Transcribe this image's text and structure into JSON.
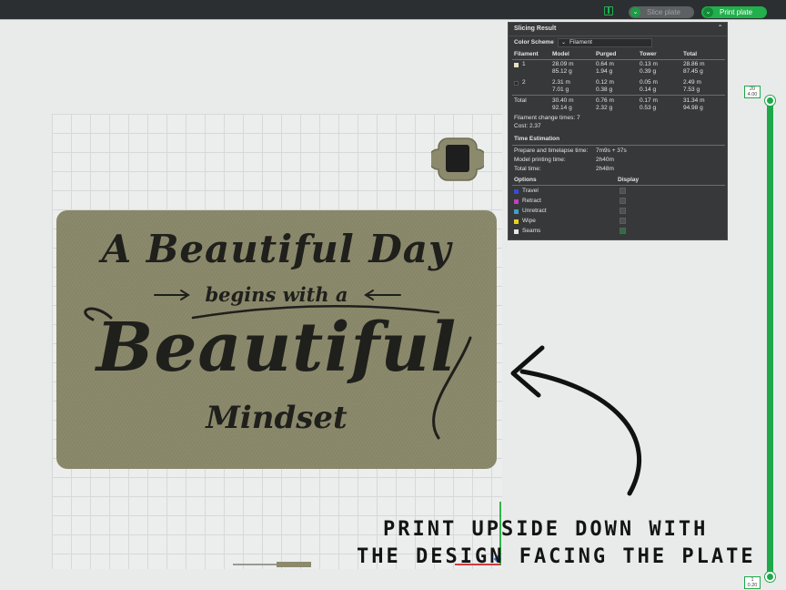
{
  "toolbar": {
    "slice_label": "Slice plate",
    "print_label": "Print plate",
    "layout_icon": "layout-icon",
    "dropdown_icon": "chevron-down-icon",
    "colors": {
      "accent": "#21b04b",
      "bar": "#2c2f31"
    }
  },
  "model": {
    "line1": "A Beautiful Day",
    "line2": "begins with a",
    "line3": "Beautiful",
    "line4": "Mindset",
    "color": "#8c8a6c"
  },
  "slicing_result": {
    "title": "Slicing Result",
    "color_scheme_label": "Color Scheme",
    "color_scheme_value": "Filament",
    "headers": [
      "Filament",
      "Model",
      "Purged",
      "Tower",
      "Total"
    ],
    "rows": [
      {
        "id": "1",
        "color": "#e6e1c4",
        "model": [
          "28.09 m",
          "85.12 g"
        ],
        "purged": [
          "0.64 m",
          "1.94 g"
        ],
        "tower": [
          "0.13 m",
          "0.39 g"
        ],
        "total": [
          "28.86 m",
          "87.45 g"
        ]
      },
      {
        "id": "2",
        "color": "#2a2a2a",
        "model": [
          "2.31 m",
          "7.01 g"
        ],
        "purged": [
          "0.12 m",
          "0.38 g"
        ],
        "tower": [
          "0.05 m",
          "0.14 g"
        ],
        "total": [
          "2.49 m",
          "7.53 g"
        ]
      }
    ],
    "total_row": {
      "label": "Total",
      "model": [
        "30.40 m",
        "92.14 g"
      ],
      "purged": [
        "0.76 m",
        "2.32 g"
      ],
      "tower": [
        "0.17 m",
        "0.53 g"
      ],
      "total": [
        "31.34 m",
        "94.98 g"
      ]
    },
    "filament_changes": "Filament change times:  7",
    "cost": "Cost:  2.37",
    "time_title": "Time Estimation",
    "time_rows": [
      {
        "label": "Prepare and timelapse time:",
        "value": "7m9s + 37s"
      },
      {
        "label": "Model printing time:",
        "value": "2h40m"
      },
      {
        "label": "Total time:",
        "value": "2h48m"
      }
    ],
    "options_header": "Options",
    "display_header": "Display",
    "options": [
      {
        "label": "Travel",
        "color": "#3b4bd8",
        "checked": false
      },
      {
        "label": "Retract",
        "color": "#c040c0",
        "checked": false
      },
      {
        "label": "Unretract",
        "color": "#3fa0c8",
        "checked": false
      },
      {
        "label": "Wipe",
        "color": "#e8d020",
        "checked": false
      },
      {
        "label": "Seams",
        "color": "#e6e6e6",
        "checked": true
      }
    ]
  },
  "layer_slider": {
    "top_layer": "20",
    "top_height": "4.00",
    "bottom_layer": "1",
    "bottom_height": "0.20"
  },
  "annotation": {
    "line1": "PRINT UPSIDE DOWN WITH",
    "line2": "THE DESIGN FACING THE PLATE"
  }
}
